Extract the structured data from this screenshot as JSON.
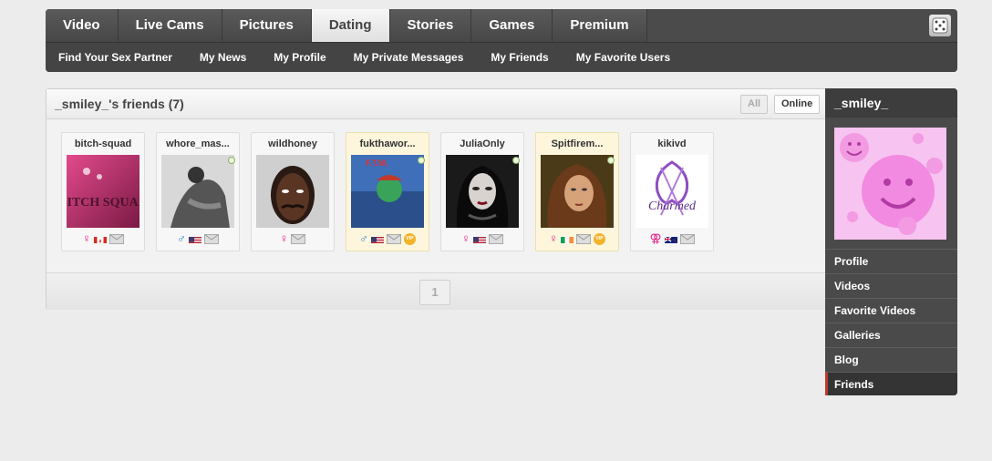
{
  "nav": {
    "tabs": [
      "Video",
      "Live Cams",
      "Pictures",
      "Dating",
      "Stories",
      "Games",
      "Premium"
    ],
    "active_tab": "Dating",
    "subnav": [
      "Find Your Sex Partner",
      "My News",
      "My Profile",
      "My Private Messages",
      "My Friends",
      "My Favorite Users"
    ]
  },
  "friends": {
    "title": "_smiley_'s friends (7)",
    "filter_all": "All",
    "filter_online": "Online",
    "page": "1",
    "cards": [
      {
        "name": "bitch-squad",
        "gender": "female",
        "gender_symbol": "♀",
        "flag": "canada",
        "vip": false,
        "online": false,
        "photo_text": "BITCH SQUAD"
      },
      {
        "name": "whore_mas...",
        "gender": "male",
        "gender_symbol": "♂",
        "flag": "usa",
        "vip": false,
        "online": true,
        "photo_text": ""
      },
      {
        "name": "wildhoney",
        "gender": "female",
        "gender_symbol": "♀",
        "flag": "none",
        "vip": false,
        "online": false,
        "photo_text": ""
      },
      {
        "name": "fukthawor...",
        "gender": "male",
        "gender_symbol": "♂",
        "flag": "usa",
        "vip": true,
        "online": true,
        "photo_text": "F.T.W."
      },
      {
        "name": "JuliaOnly",
        "gender": "female",
        "gender_symbol": "♀",
        "flag": "usa",
        "vip": false,
        "online": true,
        "photo_text": ""
      },
      {
        "name": "Spitfirem...",
        "gender": "female",
        "gender_symbol": "♀",
        "flag": "ireland",
        "vip": true,
        "online": true,
        "photo_text": ""
      },
      {
        "name": "kikivd",
        "gender": "couple-female",
        "gender_symbol": "⚢",
        "flag": "new-zealand",
        "vip": false,
        "online": false,
        "photo_text": "Charmed"
      }
    ]
  },
  "sidebar": {
    "username": "_smiley_",
    "menu": [
      "Profile",
      "Videos",
      "Favorite Videos",
      "Galleries",
      "Blog",
      "Friends"
    ],
    "active": "Friends"
  },
  "colors": {
    "female": "#e0218a",
    "male": "#1e7fd8",
    "vip": "#f4b32b",
    "active_marker": "#c0392b"
  }
}
